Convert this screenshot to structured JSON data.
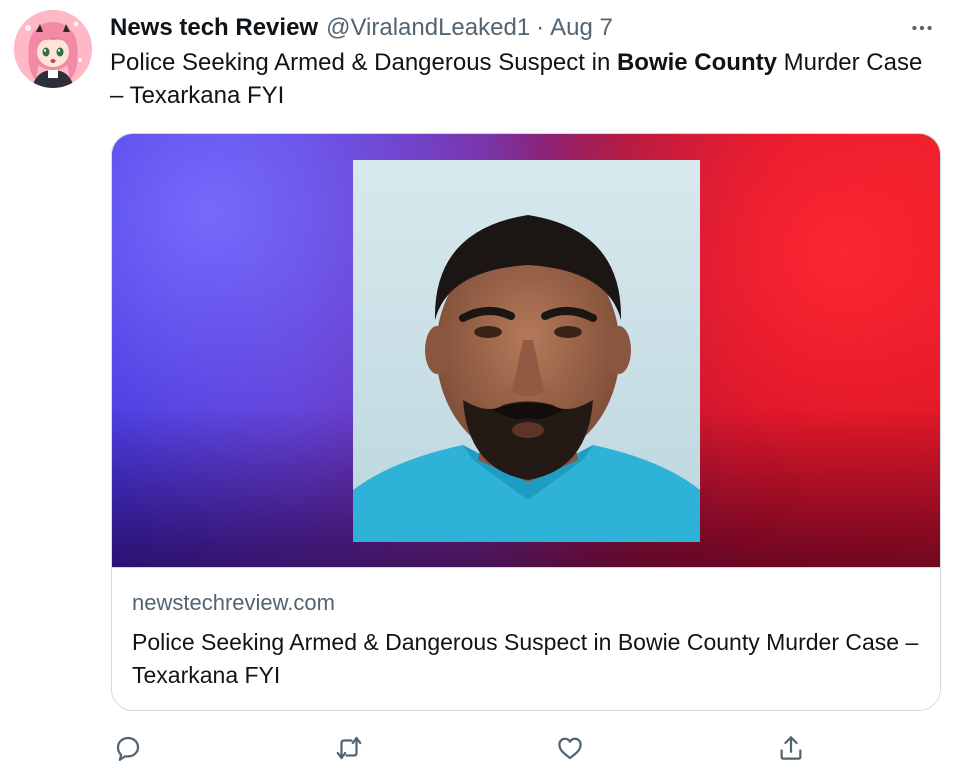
{
  "tweet": {
    "display_name": "News tech Review",
    "handle": "@ViralandLeaked1",
    "separator": "·",
    "date": "Aug 7",
    "text_part1": "Police Seeking Armed & Dangerous Suspect in ",
    "text_bold": "Bowie County",
    "text_part2": " Murder Case – Texarkana FYI"
  },
  "card": {
    "domain": "newstechreview.com",
    "title": "Police Seeking Armed & Dangerous Suspect in Bowie County Murder Case – Texarkana FYI"
  },
  "icons": {
    "more": "more-options-icon",
    "reply": "reply-icon",
    "retweet": "retweet-icon",
    "like": "like-icon",
    "share": "share-icon"
  },
  "colors": {
    "text_primary": "#0f1419",
    "text_secondary": "#536471",
    "border": "#cfd9de",
    "background": "#ffffff"
  }
}
